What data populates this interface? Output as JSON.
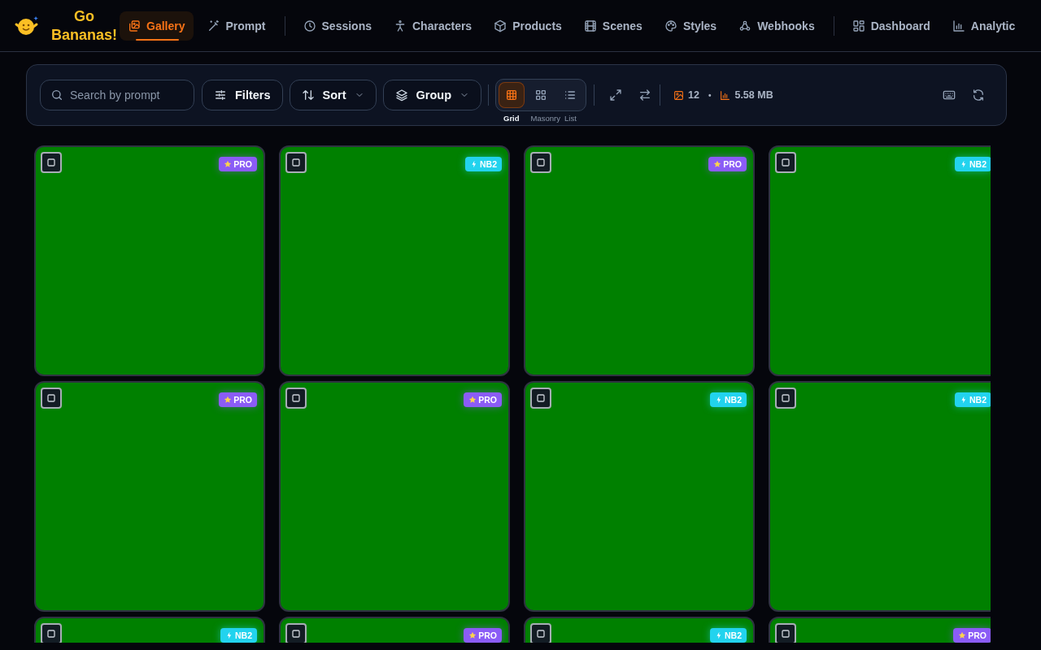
{
  "app": {
    "name_line_1": "Go",
    "name_line_2": "Bananas!"
  },
  "nav": [
    {
      "label": "Gallery",
      "selected": true
    },
    {
      "label": "Prompt",
      "selected": false
    },
    {
      "kind": "divider"
    },
    {
      "label": "Sessions",
      "selected": false
    },
    {
      "label": "Characters",
      "selected": false
    },
    {
      "label": "Products",
      "selected": false
    },
    {
      "label": "Scenes",
      "selected": false
    },
    {
      "label": "Styles",
      "selected": false
    },
    {
      "label": "Webhooks",
      "selected": false
    },
    {
      "kind": "divider"
    },
    {
      "label": "Dashboard",
      "selected": false
    },
    {
      "label": "Analytic",
      "selected": false
    }
  ],
  "toolbar": {
    "search": {
      "placeholder": "Search by prompt"
    },
    "filters": "Filters",
    "sort": "Sort",
    "group": "Group",
    "views": [
      {
        "label": "Grid",
        "selected": true
      },
      {
        "label": "Masonry",
        "selected": false
      },
      {
        "label": "List",
        "selected": false
      }
    ],
    "image_count": "12",
    "separator": "•",
    "total_size": "5.58 MB"
  },
  "images": [
    {
      "badge": "PRO",
      "kind": "pro"
    },
    {
      "badge": "NB2",
      "kind": "nb2"
    },
    {
      "badge": "PRO",
      "kind": "pro"
    },
    {
      "badge": "NB2",
      "kind": "nb2"
    },
    {
      "badge": "PRO",
      "kind": "pro"
    },
    {
      "badge": "PRO",
      "kind": "pro"
    },
    {
      "badge": "NB2",
      "kind": "nb2"
    },
    {
      "badge": "NB2",
      "kind": "nb2"
    },
    {
      "badge": "NB2",
      "kind": "nb2"
    },
    {
      "badge": "PRO",
      "kind": "pro"
    },
    {
      "badge": "NB2",
      "kind": "nb2"
    },
    {
      "badge": "PRO",
      "kind": "pro"
    }
  ]
}
